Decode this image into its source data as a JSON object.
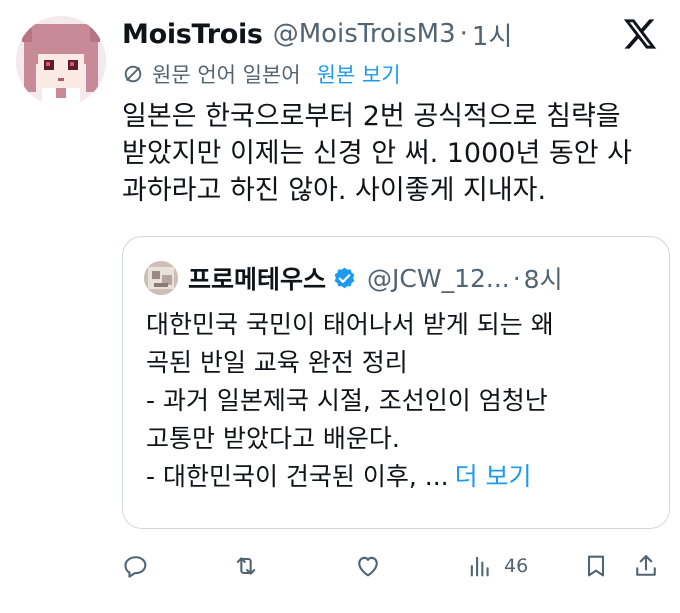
{
  "post": {
    "display_name": "MoisTrois",
    "handle": "@MoisTroisM3",
    "separator": "·",
    "time": "1시",
    "translation": {
      "label": "원문 언어 일본어",
      "link": "원본 보기"
    },
    "text_lines": [
      "일본은 한국으로부터 2번 공식적으로 침략을",
      "받았지만 이제는 신경 안 써. 1000년 동안 사",
      "과하라고 하진 않아. 사이좋게 지내자."
    ]
  },
  "quote": {
    "display_name": "프로메테우스",
    "handle": "@JCW_12...",
    "separator": "·",
    "time": "8시",
    "text_lines": [
      "대한민국 국민이 태어나서 받게 되는 왜",
      "곡된 반일 교육 완전 정리",
      "- 과거 일본제국 시절, 조선인이 엄청난",
      "고통만 받았다고 배운다.",
      "- 대한민국이 건국된 이후, ..."
    ],
    "more_link": "더 보기"
  },
  "actions": {
    "views_count": "46"
  },
  "icons": {
    "x_logo": "x-logo-icon",
    "translate": "translate-icon",
    "verified": "verified-badge-icon",
    "reply": "reply-icon",
    "repost": "repost-icon",
    "like": "heart-icon",
    "views": "views-icon",
    "bookmark": "bookmark-icon",
    "share": "share-icon"
  },
  "colors": {
    "link": "#1d9bf0",
    "secondary": "#536471",
    "text": "#0f1419",
    "border": "#cfd9de"
  }
}
